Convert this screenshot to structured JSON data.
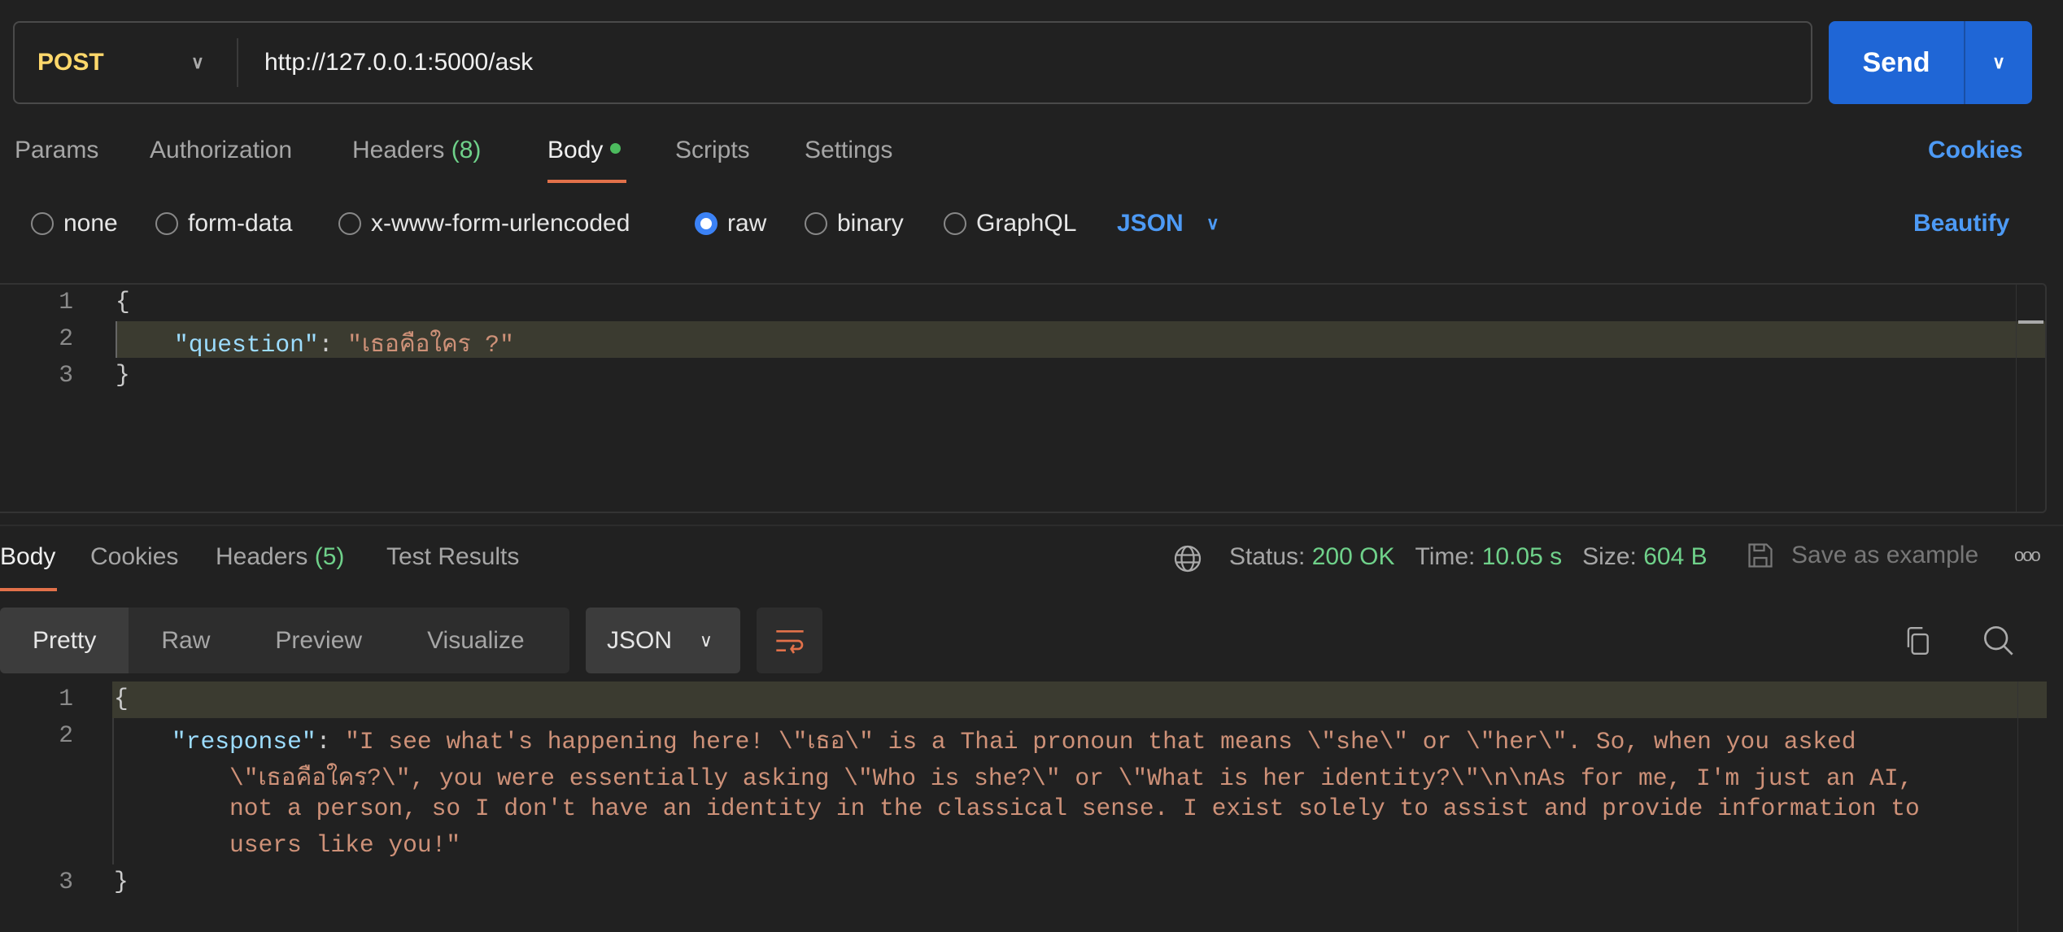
{
  "request": {
    "method": "POST",
    "url": "http://127.0.0.1:5000/ask",
    "send_label": "Send"
  },
  "req_tabs": [
    "Params",
    "Authorization",
    "Headers",
    "Body",
    "Scripts",
    "Settings"
  ],
  "headers_count": "(8)",
  "cookies_label": "Cookies",
  "body_types": [
    "none",
    "form-data",
    "x-www-form-urlencoded",
    "raw",
    "binary",
    "GraphQL"
  ],
  "selected_body_type": "raw",
  "format": "JSON",
  "beautify_label": "Beautify",
  "request_body": {
    "line1": "{",
    "key": "\"question\"",
    "colon": ": ",
    "value": "\"เธอคือใคร ?\"",
    "line3": "}"
  },
  "resp_tabs": [
    "Body",
    "Cookies",
    "Headers",
    "Test Results"
  ],
  "resp_headers_count": "(5)",
  "status": {
    "status_label": "Status:",
    "status": "200 OK",
    "time_label": "Time:",
    "time": "10.05 s",
    "size_label": "Size:",
    "size": "604 B",
    "save_label": "Save as example"
  },
  "view_modes": [
    "Pretty",
    "Raw",
    "Preview",
    "Visualize"
  ],
  "resp_format": "JSON",
  "response_body": {
    "line1": "{",
    "key": "\"response\"",
    "colon": ": ",
    "v1": "\"I see what's happening here! \\\"เธอ\\\" is a Thai pronoun that means \\\"she\\\" or \\\"her\\\". So, when you asked",
    "v2": "\\\"เธอคือใคร?\\\", you were essentially asking \\\"Who is she?\\\" or \\\"What is her identity?\\\"\\n\\nAs for me, I'm just an AI,",
    "v3": "not a person, so I don't have an identity in the classical sense. I exist solely to assist and provide information to",
    "v4": "users like you!\"",
    "line3": "}"
  },
  "colors": {
    "accent": "#1f66d6",
    "method": "#ffd86b",
    "success": "#6fd18a",
    "tab_underline": "#e2714a"
  }
}
